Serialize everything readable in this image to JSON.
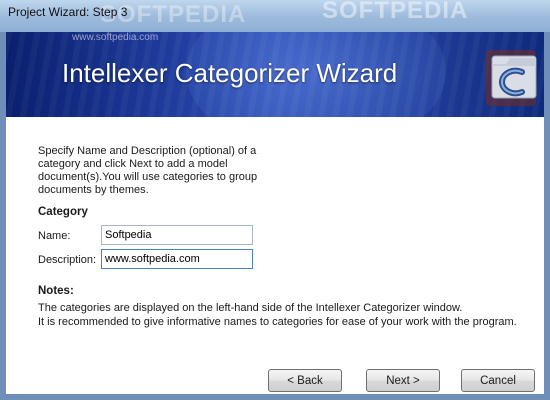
{
  "window": {
    "title": "Project Wizard: Step 3",
    "watermark_text": "SOFTPEDIA",
    "watermark_url": "www.softpedia.com"
  },
  "banner": {
    "heading": "Intellexer Categorizer Wizard",
    "icon": "categorizer-app-icon",
    "colors": {
      "dark": "#0a1f6e",
      "mid": "#2f4fb3"
    }
  },
  "content": {
    "description": "Specify Name and Description (optional) of a category and click Next to add a model document(s).You will use categories to group documents by themes.",
    "category_label": "Category",
    "name_label": "Name:",
    "name_value": "Softpedia",
    "description_label": "Description:",
    "description_value": "www.softpedia.com",
    "notes_label": "Notes:",
    "notes_line1": "The categories are displayed on the left-hand side of the Intellexer Categorizer window.",
    "notes_line2": "It is recommended to give informative names to categories for ease of your work with the program."
  },
  "buttons": {
    "back": "< Back",
    "next": "Next >",
    "cancel": "Cancel"
  }
}
